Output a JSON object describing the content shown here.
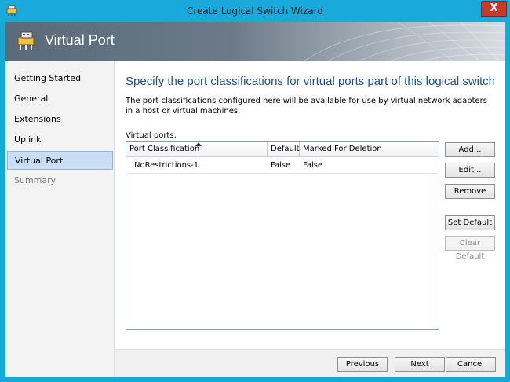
{
  "window": {
    "title": "Create Logical Switch Wizard",
    "close_label": "X"
  },
  "header": {
    "title": "Virtual Port",
    "icon": "network-switch-icon"
  },
  "sidebar": {
    "items": [
      {
        "label": "Getting Started",
        "state": "normal"
      },
      {
        "label": "General",
        "state": "normal"
      },
      {
        "label": "Extensions",
        "state": "normal"
      },
      {
        "label": "Uplink",
        "state": "normal"
      },
      {
        "label": "Virtual Port",
        "state": "active"
      },
      {
        "label": "Summary",
        "state": "disabled"
      }
    ]
  },
  "main": {
    "heading": "Specify the port classifications for virtual ports part of this logical switch",
    "description": "The port classifications configured here will be available for use by virtual network adapters in a host or virtual machines.",
    "grid_label": "Virtual ports:",
    "columns": [
      "Port Classification",
      "Default",
      "Marked For Deletion"
    ],
    "rows": [
      {
        "port_classification": "NoRestrictions-1",
        "default": "False",
        "marked_for_deletion": "False"
      }
    ],
    "buttons": {
      "add": "Add...",
      "edit": "Edit...",
      "remove": "Remove",
      "set_default": "Set Default",
      "clear_default": "Clear Default"
    }
  },
  "footer": {
    "previous": "Previous",
    "next": "Next",
    "cancel": "Cancel"
  },
  "colors": {
    "frame": "#19a9da",
    "heading": "#1e4f8c",
    "active_nav": "#c9def5"
  }
}
